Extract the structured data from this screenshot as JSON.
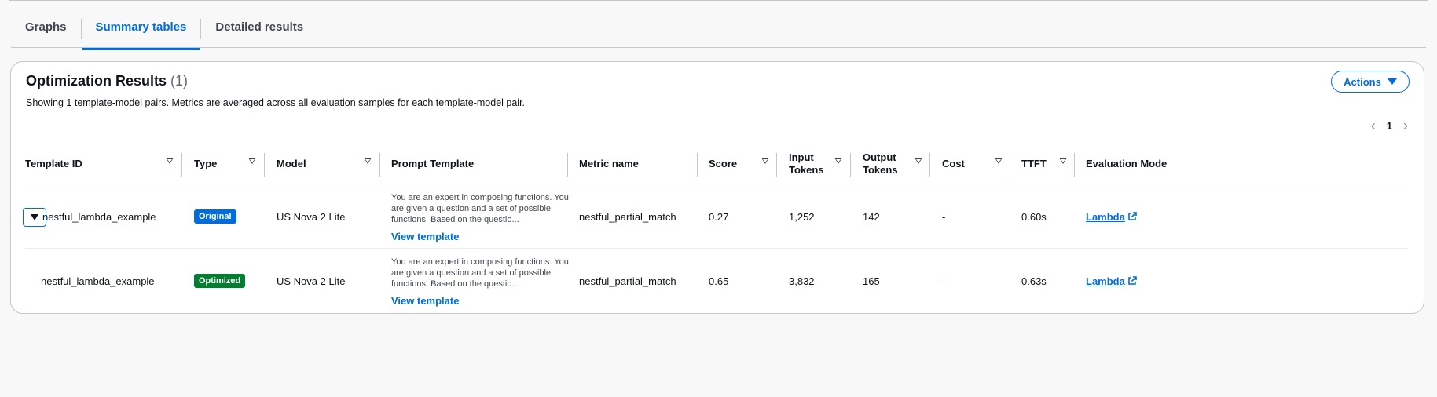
{
  "tabs": [
    {
      "label": "Graphs",
      "active": false
    },
    {
      "label": "Summary tables",
      "active": true
    },
    {
      "label": "Detailed results",
      "active": false
    }
  ],
  "panel": {
    "title": "Optimization Results",
    "count": "(1)",
    "description": "Showing 1 template-model pairs. Metrics are averaged across all evaluation samples for each template-model pair.",
    "actions_label": "Actions",
    "page": "1"
  },
  "columns": {
    "template_id": "Template ID",
    "type": "Type",
    "model": "Model",
    "prompt_template": "Prompt Template",
    "metric_name": "Metric name",
    "score": "Score",
    "input_tokens_1": "Input",
    "input_tokens_2": "Tokens",
    "output_tokens_1": "Output",
    "output_tokens_2": "Tokens",
    "cost": "Cost",
    "ttft": "TTFT",
    "evaluation_mode": "Evaluation Mode"
  },
  "rows": [
    {
      "template_id": "nestful_lambda_example",
      "type": "Original",
      "model": "US Nova 2 Lite",
      "prompt_preview": "You are an expert in composing functions. You are given a question and a set of possible functions. Based on the questio...",
      "view_template": "View template",
      "metric_name": "nestful_partial_match",
      "score": "0.27",
      "input_tokens": "1,252",
      "output_tokens": "142",
      "cost": "-",
      "ttft": "0.60s",
      "evaluation_mode": "Lambda"
    },
    {
      "template_id": "nestful_lambda_example",
      "type": "Optimized",
      "model": "US Nova 2 Lite",
      "prompt_preview": "You are an expert in composing functions. You are given a question and a set of possible functions. Based on the questio...",
      "view_template": "View template",
      "metric_name": "nestful_partial_match",
      "score": "0.65",
      "input_tokens": "3,832",
      "output_tokens": "165",
      "cost": "-",
      "ttft": "0.63s",
      "evaluation_mode": "Lambda"
    }
  ],
  "icons": {
    "expand": "caret-down-icon",
    "sort": "sort-caret-icon",
    "pager_prev": "chevron-left-icon",
    "pager_next": "chevron-right-icon",
    "external": "external-link-icon"
  },
  "colors": {
    "accent": "#006ce0",
    "original_badge": "#006ce0",
    "optimized_badge": "#00802f"
  }
}
